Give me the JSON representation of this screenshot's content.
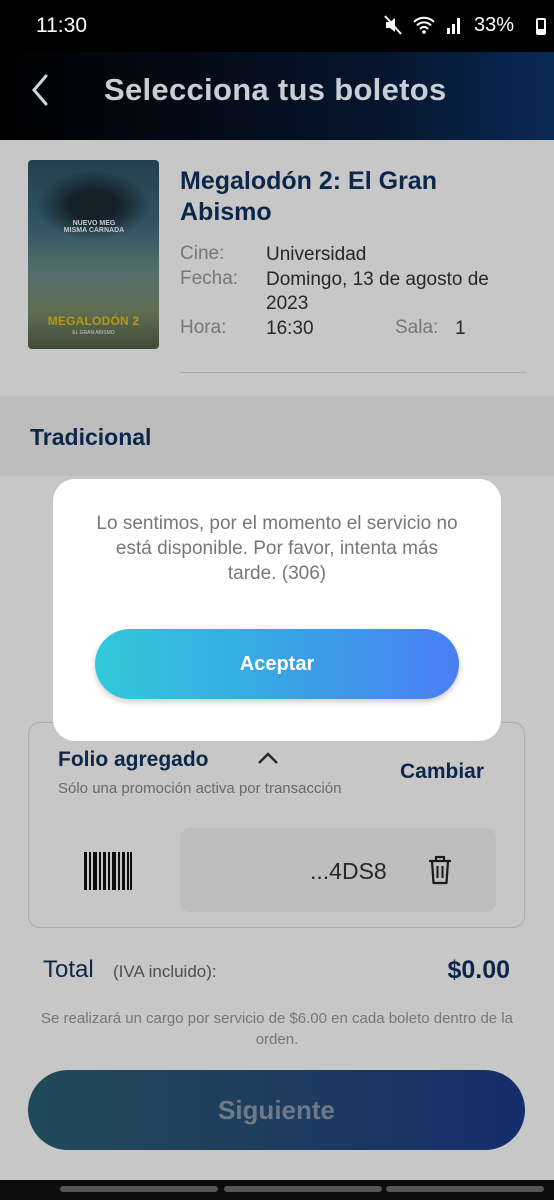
{
  "status_bar": {
    "time": "11:30",
    "battery": "33%",
    "icons": [
      "mute-icon",
      "wifi-icon",
      "signal-icon",
      "battery-icon"
    ]
  },
  "header": {
    "title": "Selecciona tus boletos",
    "back_icon": "chevron-left-icon"
  },
  "movie": {
    "title": "Megalodón 2: El Gran Abismo",
    "poster": {
      "tagline": "NUEVO MEG\nMISMA CARNADA",
      "logo_text": "MEGALODÓN 2",
      "subtitle": "EL GRAN ABISMO"
    },
    "cinema_label": "Cine:",
    "cinema": "Universidad",
    "date_label": "Fecha:",
    "date": "Domingo, 13 de agosto de 2023",
    "time_label": "Hora:",
    "time": "16:30",
    "room_label": "Sala:",
    "room": "1"
  },
  "section": {
    "title": "Tradicional"
  },
  "promo": {
    "title": "Folio agregado",
    "change_label": "Cambiar",
    "note": "Sólo una promoción activa por transacción",
    "code": "...4DS8"
  },
  "totals": {
    "label": "Total",
    "iva": "(IVA incluido):",
    "amount": "$0.00",
    "service_note": "Se realizará un cargo por servicio de $6.00 en cada boleto dentro de la orden."
  },
  "next_button": "Siguiente",
  "dialog": {
    "message": "Lo sentimos, por el momento el servicio no está disponible. Por favor, intenta más tarde. (306)",
    "accept": "Aceptar"
  },
  "colors": {
    "brand_navy": "#10325f",
    "accept_gradient_start": "#31c9d9",
    "accept_gradient_end": "#4b7ff5"
  }
}
